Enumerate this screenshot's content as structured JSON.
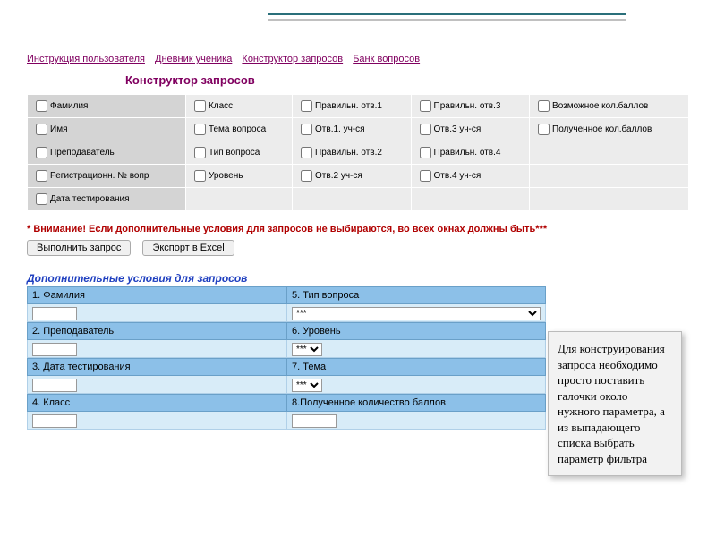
{
  "nav": {
    "link1": "Инструкция пользователя",
    "link2": "Дневник ученика",
    "link3": "Конструктор запросов",
    "link4": "Банк вопросов"
  },
  "title": "Конструктор запросов",
  "grid": {
    "c0r0": "Фамилия",
    "c0r1": "Имя",
    "c0r2": "Преподаватель",
    "c0r3": "Регистрационн. № вопр",
    "c0r4": "Дата тестирования",
    "c1r0": "Класс",
    "c1r1": "Тема вопроса",
    "c1r2": "Тип вопроса",
    "c1r3": "Уровень",
    "c2r0": "Правильн. отв.1",
    "c2r1": "Отв.1. уч-ся",
    "c2r2": "Правильн. отв.2",
    "c2r3": "Отв.2 уч-ся",
    "c3r0": "Правильн. отв.3",
    "c3r1": "Отв.3 уч-ся",
    "c3r2": "Правильн. отв.4",
    "c3r3": "Отв.4 уч-ся",
    "c4r0": "Возможное кол.баллов",
    "c4r1": "Полученное кол.баллов"
  },
  "warning": "* Внимание! Если дополнительные условия для запросов не выбираются, во всех окнах должны быть***",
  "buttons": {
    "run": "Выполнить запрос",
    "export": "Экспорт в Excel"
  },
  "subtitle": "Дополнительные условия для запросов",
  "cond": {
    "l1": "1. Фамилия",
    "l2": "2. Преподаватель",
    "l3": "3. Дата тестирования",
    "l4": "4. Класс",
    "r1": "5. Тип вопроса",
    "r2": "6. Уровень",
    "r3": "7. Тема",
    "r4": "8.Полученное количество  баллов",
    "opt": "***"
  },
  "callout": "Для конструирования запроса необходимо просто  поставить галочки около нужного параметра, а из выпадающего списка выбрать параметр фильтра"
}
